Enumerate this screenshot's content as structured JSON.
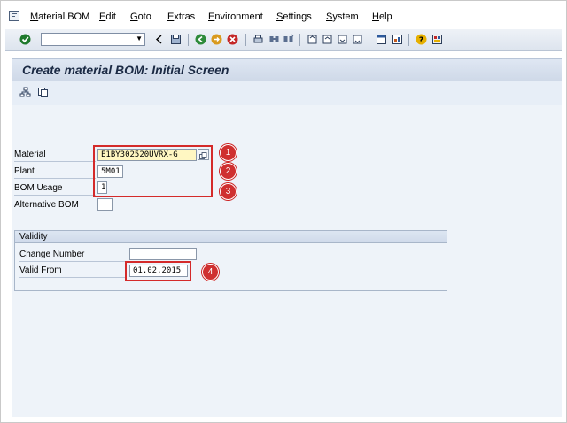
{
  "menu": {
    "items": [
      "Material BOM",
      "Edit",
      "Goto",
      "Extras",
      "Environment",
      "Settings",
      "System",
      "Help"
    ]
  },
  "toolbar": {
    "command_value": ""
  },
  "screen": {
    "title": "Create material BOM: Initial Screen"
  },
  "form": {
    "material_label": "Material",
    "material_value": "E1BY302520UVRX-G",
    "plant_label": "Plant",
    "plant_value": "5M01",
    "bom_usage_label": "BOM Usage",
    "bom_usage_value": "1",
    "alt_bom_label": "Alternative BOM",
    "alt_bom_value": ""
  },
  "validity": {
    "title": "Validity",
    "change_number_label": "Change Number",
    "change_number_value": "",
    "valid_from_label": "Valid From",
    "valid_from_value": "01.02.2015"
  },
  "annotations": {
    "badge_1": "1",
    "badge_2": "2",
    "badge_3": "3",
    "badge_4": "4",
    "highlight_color": "#d42a2a"
  }
}
